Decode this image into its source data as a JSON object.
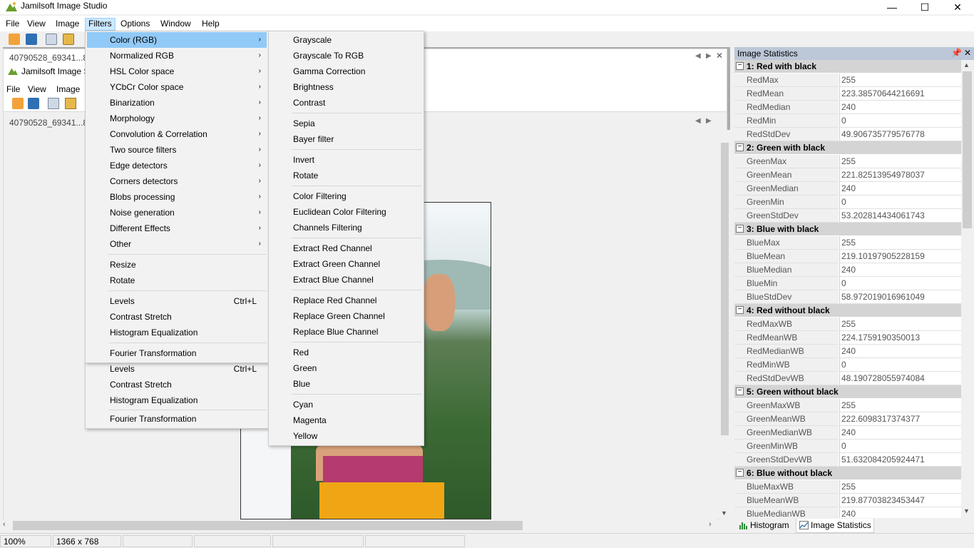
{
  "window": {
    "title": "Jamilsoft Image Studio",
    "controls": {
      "minimize": "—",
      "maximize": "☐",
      "close": "✕"
    }
  },
  "menubar": {
    "items": [
      "File",
      "View",
      "Image",
      "Filters",
      "Options",
      "Window",
      "Help"
    ],
    "active": "Filters"
  },
  "child_doc": {
    "title": "Jamilsoft Image S",
    "tab_label": "40790528_69341...8",
    "menu_items": [
      "File",
      "View",
      "Image"
    ]
  },
  "doc2": {
    "tab_label": "40790528_69341...8"
  },
  "filters_menu": {
    "items": [
      {
        "label": "Color (RGB)",
        "submenu": true,
        "highlight": true
      },
      {
        "label": "Normalized RGB",
        "submenu": true
      },
      {
        "label": "HSL Color space",
        "submenu": true
      },
      {
        "label": "YCbCr Color space",
        "submenu": true
      },
      {
        "label": "Binarization",
        "submenu": true
      },
      {
        "label": "Morphology",
        "submenu": true
      },
      {
        "label": "Convolution & Correlation",
        "submenu": true
      },
      {
        "label": "Two source filters",
        "submenu": true
      },
      {
        "label": "Edge detectors",
        "submenu": true
      },
      {
        "label": "Corners detectors",
        "submenu": true
      },
      {
        "label": "Blobs processing",
        "submenu": true
      },
      {
        "label": "Noise generation",
        "submenu": true
      },
      {
        "label": "Different Effects",
        "submenu": true
      },
      {
        "label": "Other",
        "submenu": true
      },
      {
        "label": "Resize"
      },
      {
        "label": "Rotate"
      },
      {
        "label": "Levels",
        "shortcut": "Ctrl+L"
      },
      {
        "label": "Contrast Stretch"
      },
      {
        "label": "Histogram Equalization"
      },
      {
        "label": "Fourier Transformation"
      }
    ]
  },
  "behind_menu": {
    "items": [
      {
        "label": "Levels",
        "shortcut": "Ctrl+L"
      },
      {
        "label": "Contrast Stretch"
      },
      {
        "label": "Histogram Equalization"
      },
      {
        "label": "Fourier Transformation"
      }
    ]
  },
  "color_submenu": {
    "groups": [
      [
        "Grayscale",
        "Grayscale To RGB",
        "Gamma Correction",
        "Brightness",
        "Contrast"
      ],
      [
        "Sepia",
        "Bayer filter"
      ],
      [
        "Invert",
        "Rotate"
      ],
      [
        "Color Filtering",
        "Euclidean Color Filtering",
        "Channels Filtering"
      ],
      [
        "Extract Red Channel",
        "Extract Green Channel",
        "Extract Blue Channel"
      ],
      [
        "Replace Red Channel",
        "Replace Green Channel",
        "Replace Blue Channel"
      ],
      [
        "Red",
        "Green",
        "Blue"
      ],
      [
        "Cyan",
        "Magenta",
        "Yellow"
      ]
    ]
  },
  "stats_panel": {
    "title": "Image Statistics",
    "categories": [
      {
        "name": "1: Red with black",
        "props": [
          [
            "RedMax",
            "255"
          ],
          [
            "RedMean",
            "223.38570644216691"
          ],
          [
            "RedMedian",
            "240"
          ],
          [
            "RedMin",
            "0"
          ],
          [
            "RedStdDev",
            "49.906735779576778"
          ]
        ]
      },
      {
        "name": "2: Green with black",
        "props": [
          [
            "GreenMax",
            "255"
          ],
          [
            "GreenMean",
            "221.82513954978037"
          ],
          [
            "GreenMedian",
            "240"
          ],
          [
            "GreenMin",
            "0"
          ],
          [
            "GreenStdDev",
            "53.202814434061743"
          ]
        ]
      },
      {
        "name": "3: Blue with black",
        "props": [
          [
            "BlueMax",
            "255"
          ],
          [
            "BlueMean",
            "219.10197905228159"
          ],
          [
            "BlueMedian",
            "240"
          ],
          [
            "BlueMin",
            "0"
          ],
          [
            "BlueStdDev",
            "58.972019016961049"
          ]
        ]
      },
      {
        "name": "4: Red without black",
        "props": [
          [
            "RedMaxWB",
            "255"
          ],
          [
            "RedMeanWB",
            "224.1759190350013"
          ],
          [
            "RedMedianWB",
            "240"
          ],
          [
            "RedMinWB",
            "0"
          ],
          [
            "RedStdDevWB",
            "48.190728055974084"
          ]
        ]
      },
      {
        "name": "5: Green without black",
        "props": [
          [
            "GreenMaxWB",
            "255"
          ],
          [
            "GreenMeanWB",
            "222.6098317374377"
          ],
          [
            "GreenMedianWB",
            "240"
          ],
          [
            "GreenMinWB",
            "0"
          ],
          [
            "GreenStdDevWB",
            "51.632084205924471"
          ]
        ]
      },
      {
        "name": "6: Blue without black",
        "props": [
          [
            "BlueMaxWB",
            "255"
          ],
          [
            "BlueMeanWB",
            "219.87703823453447"
          ],
          [
            "BlueMedianWB",
            "240"
          ]
        ]
      }
    ],
    "tabs": [
      "Histogram",
      "Image Statistics"
    ],
    "active_tab": "Image Statistics"
  },
  "status": {
    "zoom": "100%",
    "dimensions": "1366 x 768"
  },
  "colors": {
    "menu_highlight": "#91c9f7",
    "panel_title": "#bcc7d8",
    "category_bg": "#d4d4d4"
  }
}
